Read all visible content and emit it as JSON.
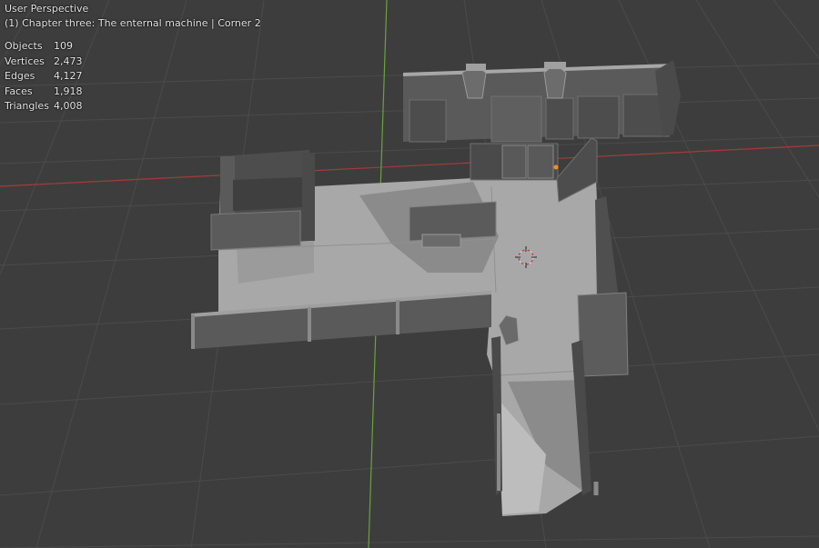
{
  "viewport": {
    "view_name": "User Perspective",
    "scene_info": "(1) Chapter three: The enternal machine | Corner 2"
  },
  "stats": [
    {
      "label": "Objects",
      "value": "109"
    },
    {
      "label": "Vertices",
      "value": "2,473"
    },
    {
      "label": "Edges",
      "value": "4,127"
    },
    {
      "label": "Faces",
      "value": "1,918"
    },
    {
      "label": "Triangles",
      "value": "4,008"
    }
  ],
  "colors": {
    "background": "#3d3d3d",
    "grid": "#4a4a4a",
    "x_axis": "#a63a3a",
    "y_axis": "#6aa33b",
    "floor": "#a9a9a9",
    "floor_shadow": "#8a8a8a",
    "wall": "#5b5b5b",
    "wall_dark": "#474747",
    "wall_top": "#b0b0b0",
    "post": "#9a9a9a",
    "selection": "#ff8c1a"
  }
}
